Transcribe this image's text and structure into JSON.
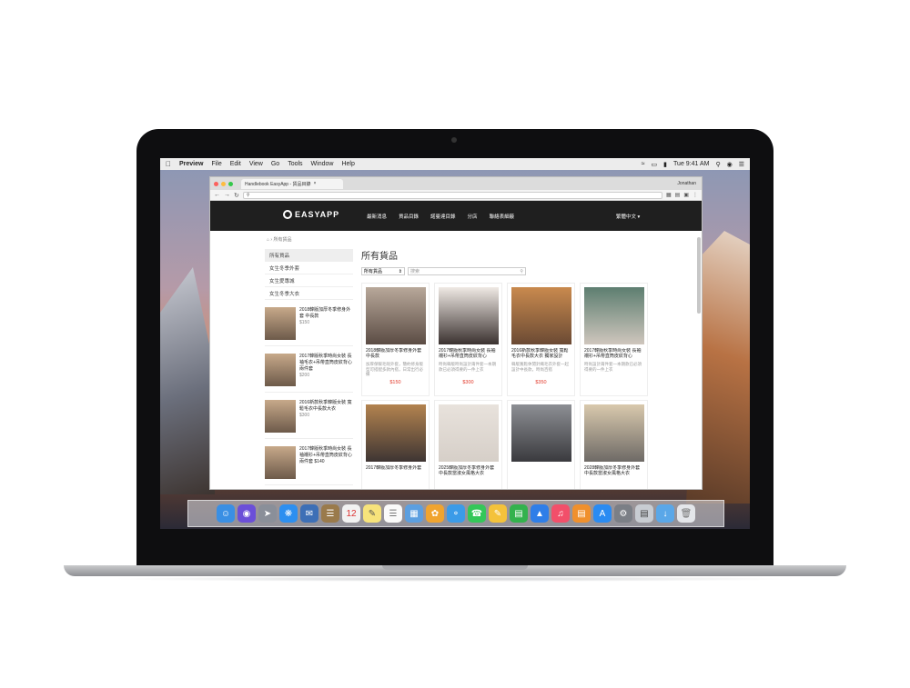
{
  "menubar": {
    "app": "Preview",
    "items": [
      "File",
      "Edit",
      "View",
      "Go",
      "Tools",
      "Window",
      "Help"
    ],
    "clock": "Tue 9:41 AM"
  },
  "browser": {
    "tab_title": "Handlebook EasyApp - 貨品目錄",
    "user": "Jonathan",
    "url": ""
  },
  "site": {
    "logo": "EASYAPP",
    "nav": [
      "最新消息",
      "貨品目錄",
      "諾曼達目錄",
      "分店",
      "聯絡表細蔽"
    ],
    "lang": "繁體中文 ▾"
  },
  "breadcrumb": "⌂  ›  所有貨品",
  "sidebar": {
    "categories": [
      "所有貨品",
      "女生冬季外套",
      "女生愛專城",
      "女生冬季大衣"
    ],
    "products": [
      {
        "title": "2018韓版加厚冬季修身外套 中長款",
        "price": "$150"
      },
      {
        "title": "2017韓版秋季時尚女裝 長袖毛衣+吊帶直筒皮紋背心兩件套",
        "price": "$200"
      },
      {
        "title": "2016新款秋季韓版女裝 寬鬆毛衣中長款大衣",
        "price": "$300"
      },
      {
        "title": "2017韓版秋季時尚女裝 長袖襯衫+吊帶直筒皮紋背心兩件套 $140",
        "price": ""
      }
    ]
  },
  "main": {
    "title": "所有貨品",
    "filter_select": "所有貨品",
    "search_placeholder": "搜索",
    "products": [
      {
        "title": "2018韓版加厚冬季修身外套 中長款",
        "desc": "加厚保暖毛呢外套，簡約修身版型可搭配多款內搭，日常出行必備",
        "price": "$150"
      },
      {
        "title": "2017韓版秋季時尚女裝 長袖襯衫+吊帶直筒皮紋背心",
        "desc": "時尚韓版時尚設計兩件套一本期款已必須得要的一件上衣",
        "price": "$300"
      },
      {
        "title": "2016新款秋季韓版女裝 寬鬆毛衣中長款大衣 獨家設計",
        "desc": "韓版寬鬆休閒針織毛衣外套一起設計中長款，時尚百搭",
        "price": "$350"
      },
      {
        "title": "2017韓版秋季時尚女裝 長袖襯衫+吊帶直筒皮紋背心",
        "desc": "時尚設計兩件套一本期款已必須得要的一件上衣",
        "price": ""
      },
      {
        "title": "2017韓版加厚冬季修身外套",
        "desc": "",
        "price": ""
      },
      {
        "title": "2025韓版加厚冬季修身外套中長款當淑女風格大衣",
        "desc": "",
        "price": ""
      },
      {
        "title": "",
        "desc": "",
        "price": ""
      },
      {
        "title": "2028韓版加厚冬季修身外套中長款當淑女風格大衣",
        "desc": "",
        "price": ""
      }
    ]
  },
  "colors": {
    "price": "#e23a2b",
    "nav_bg": "#1f1f1f"
  }
}
